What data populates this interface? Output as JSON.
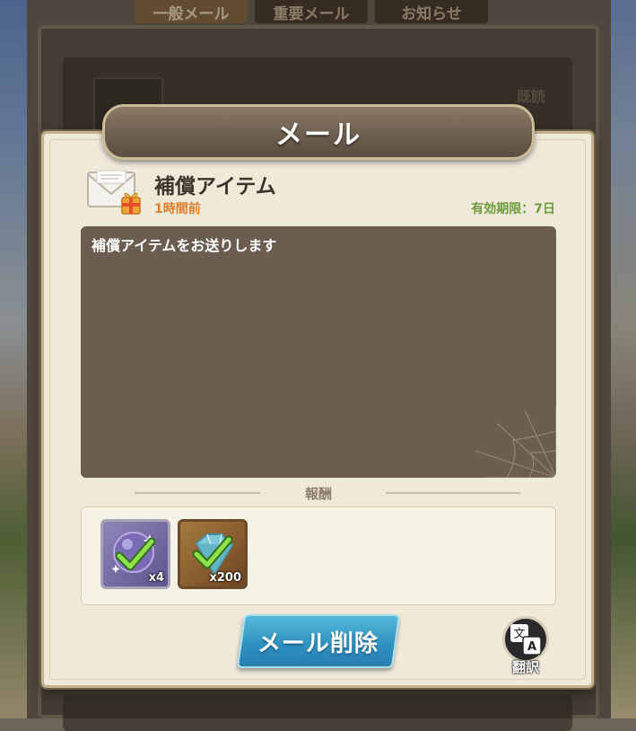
{
  "tabs": [
    {
      "label": "一般メール",
      "active": true
    },
    {
      "label": "重要メール",
      "active": false
    },
    {
      "label": "お知らせ",
      "active": false
    }
  ],
  "mail_list": {
    "row_status": "既読"
  },
  "modal": {
    "title": "メール",
    "subject": "補償アイテム",
    "time_ago": "1時間前",
    "expiry": "有効期限：7日",
    "body": "補償アイテムをお送りします",
    "reward_header": "報酬",
    "rewards": [
      {
        "icon": "purple-orb-icon",
        "quantity": "x4",
        "claimed": true
      },
      {
        "icon": "diamond-gem-icon",
        "quantity": "x200",
        "claimed": true
      }
    ],
    "delete_button": "メール削除",
    "translate_button": "翻訳"
  },
  "colors": {
    "time_ago": "#e07c2a",
    "expiry": "#6d9a3d",
    "delete_button": "#2d90c0",
    "body_bg": "#6b5d50"
  }
}
